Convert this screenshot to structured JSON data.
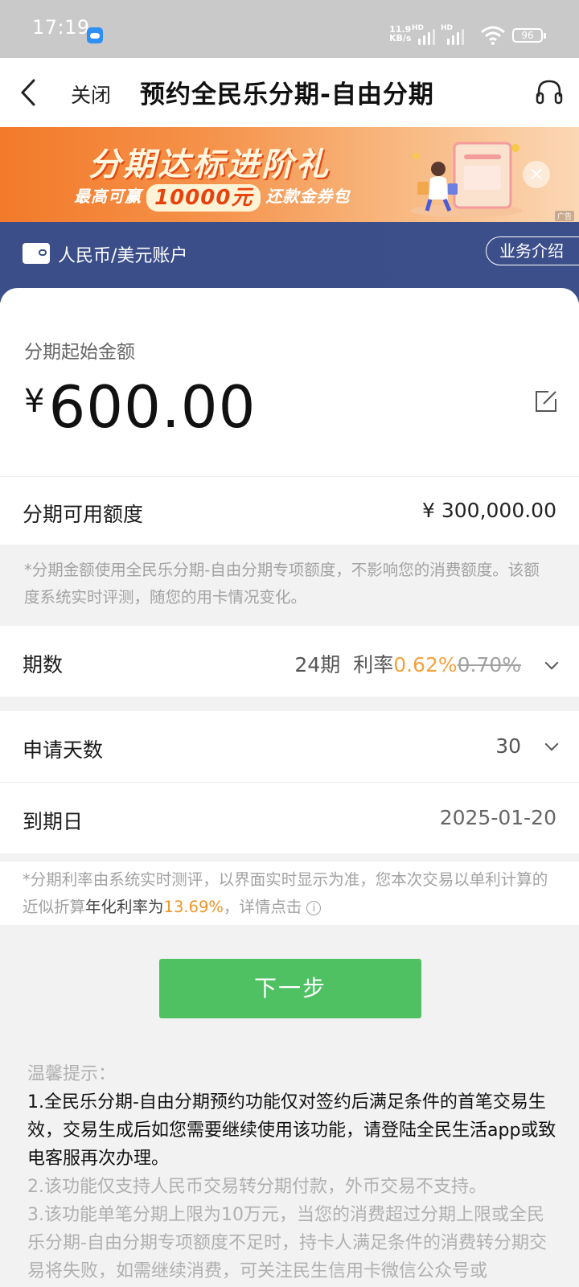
{
  "status_bar": {
    "time": "17:19",
    "net_speed_value": "11.9",
    "net_speed_unit": "KB/s",
    "sim1_tag": "HD",
    "sim2_tag": "HD",
    "battery": "96",
    "icons": [
      "weather-app-icon",
      "signal-icon",
      "wifi-icon",
      "battery-icon"
    ]
  },
  "navbar": {
    "close_label": "关闭",
    "title": "预约全民乐分期-自由分期",
    "icons": [
      "back-arrow-icon",
      "headset-icon"
    ]
  },
  "banner": {
    "title": "分期达标进阶礼",
    "sub_prefix": "最高可赢",
    "sub_amount": "10000元",
    "sub_suffix": "还款金券包",
    "ad_tag": "广告",
    "close_glyph": "×",
    "accent_color": "#f27a2a"
  },
  "account": {
    "label": "人民币/美元账户",
    "intro_button": "业务介绍",
    "bg_color": "#3b4e8a"
  },
  "amount": {
    "label": "分期起始金额",
    "currency": "¥",
    "value": "600.00"
  },
  "quota": {
    "label": "分期可用额度",
    "value": "¥ 300,000.00",
    "note": "*分期金额使用全民乐分期-自由分期专项额度，不影响您的消费额度。该额度系统实时评测，随您的用卡情况变化。"
  },
  "period": {
    "label": "期数",
    "value": "24期",
    "rate_label": "利率",
    "rate_now": "0.62%",
    "rate_old": "0.70%"
  },
  "days": {
    "label": "申请天数",
    "value": "30"
  },
  "due": {
    "label": "到期日",
    "value": "2025-01-20"
  },
  "rate_note": {
    "prefix": "*分期利率由系统实时测评，以界面实时显示为准，您本次交易以单利计算的近似折算",
    "annual_label": "年化利率为",
    "annual_value": "13.69%",
    "suffix": "，详情点击",
    "info_glyph": "i"
  },
  "next_button": "下一步",
  "tips": {
    "heading": "温馨提示：",
    "items": [
      "1.全民乐分期-自由分期预约功能仅对签约后满足条件的首笔交易生效，交易生成后如您需要继续使用该功能，请登陆全民生活app或致电客服再次办理。",
      "2.该功能仅支持人民币交易转分期付款，外币交易不支持。",
      "3.该功能单笔分期上限为10万元，当您的消费超过分期上限或全民乐分期-自由分期专项额度不足时，持卡人满足条件的消费转分期交易将失败，如需继续消费，可关注民生信用卡微信公众号或"
    ]
  },
  "colors": {
    "primary_green": "#4fc163",
    "highlight_orange": "#f4a23b"
  }
}
